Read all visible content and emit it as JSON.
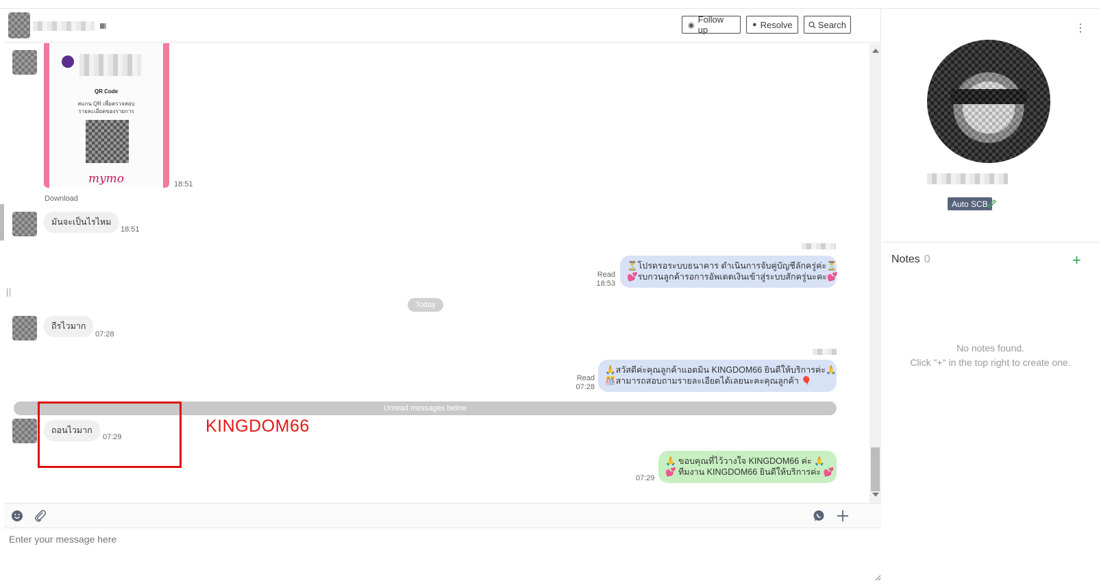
{
  "header": {
    "follow_up_label": "Follow up",
    "resolve_label": "Resolve",
    "search_label": "Search"
  },
  "messages": {
    "qr": {
      "title": "QR Code",
      "line1": "สแกน QR เพื่อตรวจสอบ",
      "line2": "รายละเอียดของรายการ",
      "brand": "mymo",
      "time": "18:51",
      "download": "Download"
    },
    "m1": {
      "text": "มันจะเป็นไรไหม",
      "time": "18:51"
    },
    "m2": {
      "line1": "⏳โปรดรอระบบธนาคาร ดำเนินการจับคู่บัญชีลักครู่ค่ะ⏳",
      "line2": "💕รบกวนลูกค้ารอการอัพเดตเงินเข้าสู่ระบบสักครู่นะคะ💕",
      "read": "Read",
      "time": "18:53"
    },
    "today": "Today",
    "m3": {
      "text": "ถีรไวมาก",
      "time": "07:28"
    },
    "m4": {
      "line1": "🙏สวัสดีค่ะคุณลูกค้าแอดมิน KINGDOM66 ยินดีให้บริการค่ะ🙏",
      "line2": "🎊สามารถสอบถามรายละเอียดได้เลยนะคะคุณลูกค้า 🎈",
      "read": "Read",
      "time": "07:28"
    },
    "unread": "Unread messages below",
    "m5": {
      "text": "ถอนไวมาก",
      "time": "07:29"
    },
    "m6": {
      "line1": "🙏 ขอบคุณที่ไว้วางใจ KINGDOM66 ค่ะ 🙏",
      "line2": "💕 ทีมงาน KINGDOM66 ยินดีให้บริการค่ะ 💕",
      "time": "07:29"
    }
  },
  "annotation": {
    "label": "KINGDOM66"
  },
  "composer": {
    "placeholder": "Enter your message here"
  },
  "profile": {
    "tag": "Auto SCB"
  },
  "notes": {
    "title": "Notes",
    "count": "0",
    "empty_line1": "No notes found.",
    "empty_line2": "Click \"+\" in the top right to create one."
  },
  "icons": {
    "follow_up": "tag-icon",
    "resolve": "chat-bubble-icon",
    "search": "search-icon",
    "emoji": "smiley-icon",
    "attach": "paperclip-icon",
    "whatsapp": "whatsapp-icon",
    "plus": "plus-icon",
    "edit": "pencil-icon",
    "menu": "kebab-icon"
  },
  "colors": {
    "outgoing_bubble": "#d8e2f6",
    "outgoing_green": "#c8efc2",
    "incoming_bubble": "#f0f0f0",
    "annotation_red": "#e51616",
    "tag_bg": "#57637a",
    "add_green": "#2aa44f"
  }
}
